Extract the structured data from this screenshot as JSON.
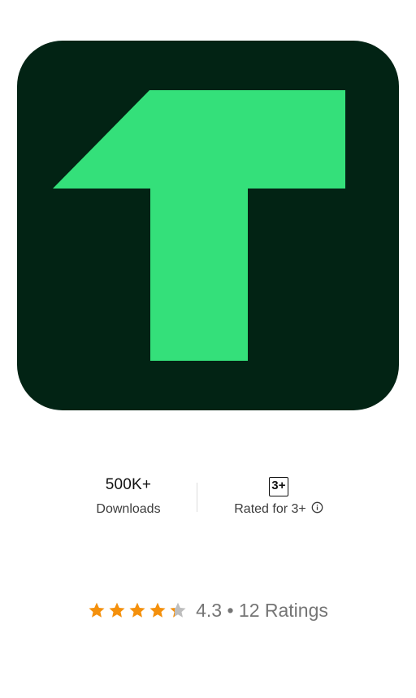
{
  "app": {
    "icon_name": "app-logo-t-icon",
    "icon_background": "#022314",
    "icon_foreground": "#34e07a"
  },
  "stats": {
    "downloads_value": "500K+",
    "downloads_label": "Downloads",
    "age_badge": "3+",
    "age_label": "Rated for 3+",
    "info_icon": "info-icon"
  },
  "ratings": {
    "stars_value": 4.3,
    "star_color": "#f4900c",
    "star_empty_color": "#bdbdbd",
    "score": "4.3",
    "separator": "•",
    "count_text": "12 Ratings"
  }
}
